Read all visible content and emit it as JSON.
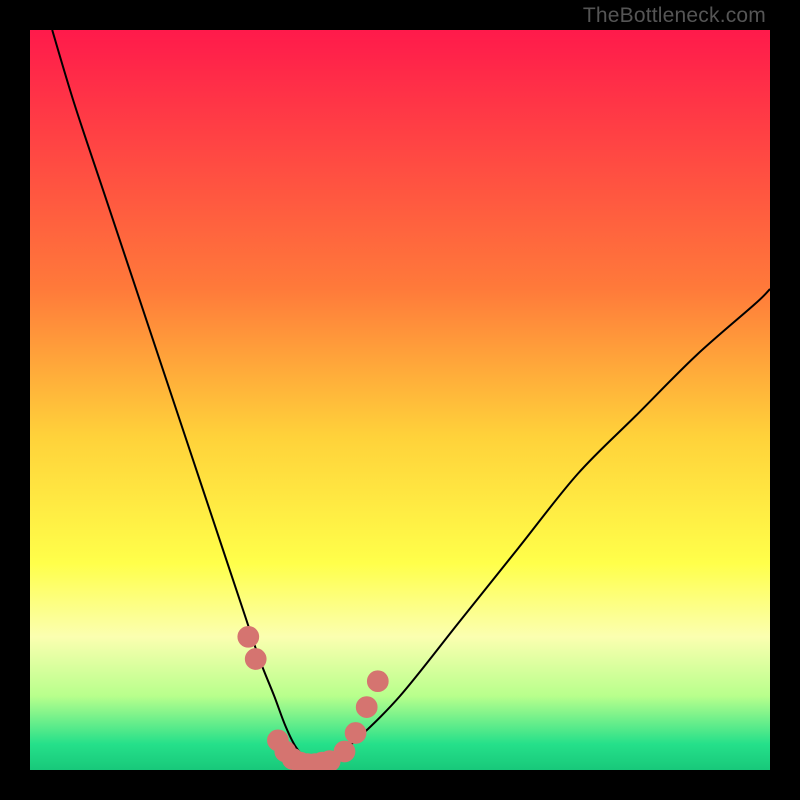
{
  "watermark": "TheBottleneck.com",
  "chart_data": {
    "type": "line",
    "title": "",
    "xlabel": "",
    "ylabel": "",
    "xlim": [
      0,
      100
    ],
    "ylim": [
      0,
      100
    ],
    "grid": false,
    "legend": false,
    "background_gradient": {
      "stops": [
        {
          "pos": 0.0,
          "color": "#ff1a4b"
        },
        {
          "pos": 0.35,
          "color": "#ff7a3a"
        },
        {
          "pos": 0.55,
          "color": "#ffd23a"
        },
        {
          "pos": 0.72,
          "color": "#ffff4a"
        },
        {
          "pos": 0.82,
          "color": "#fbffb0"
        },
        {
          "pos": 0.9,
          "color": "#b8ff8c"
        },
        {
          "pos": 0.965,
          "color": "#25e08a"
        },
        {
          "pos": 1.0,
          "color": "#18c87a"
        }
      ]
    },
    "series": [
      {
        "name": "bottleneck-curve",
        "stroke": "#000000",
        "stroke_width": 2,
        "x": [
          3,
          6,
          10,
          14,
          18,
          22,
          26,
          29,
          31,
          33,
          34.5,
          36,
          38,
          40,
          44,
          50,
          58,
          66,
          74,
          82,
          90,
          98,
          100
        ],
        "y": [
          100,
          90,
          78,
          66,
          54,
          42,
          30,
          21,
          15,
          10,
          6,
          3,
          1,
          1,
          4,
          10,
          20,
          30,
          40,
          48,
          56,
          63,
          65
        ]
      },
      {
        "name": "highlight-dots",
        "type": "scatter",
        "stroke": "#d57470",
        "fill": "#d57470",
        "marker_radius": 1.4,
        "x": [
          29.5,
          30.5,
          33.5,
          34.5,
          35.5,
          36.5,
          37.5,
          38.5,
          39.5,
          40.5,
          42.5,
          44.0,
          45.5,
          47.0
        ],
        "y": [
          18.0,
          15.0,
          4.0,
          2.5,
          1.5,
          1.0,
          0.8,
          0.8,
          1.0,
          1.2,
          2.5,
          5.0,
          8.5,
          12.0
        ]
      }
    ]
  }
}
